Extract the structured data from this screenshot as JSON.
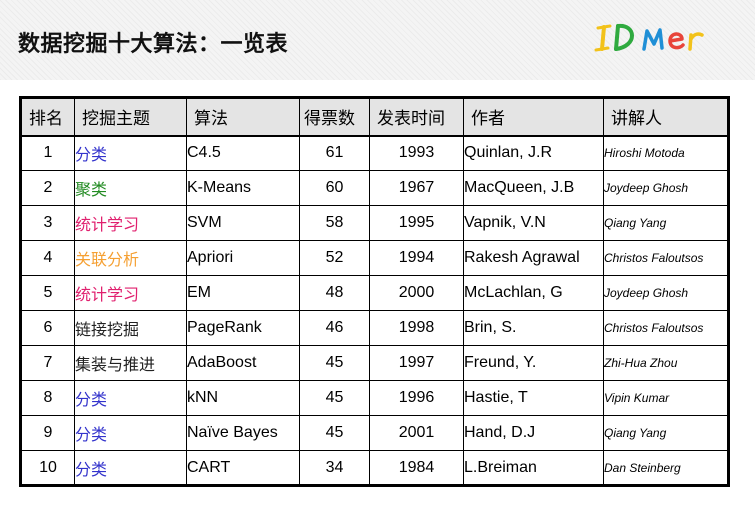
{
  "page": {
    "title": "数据挖掘十大算法：一览表",
    "logo_text": "IDMer"
  },
  "colors": {
    "topic_classification": "#3333cc",
    "topic_clustering": "#228b22",
    "topic_statistical_learning": "#e0206e",
    "topic_association": "#f5a033",
    "topic_default": "#222222",
    "header_background": "#e4e4e4"
  },
  "table": {
    "headers": {
      "rank": "排名",
      "topic": "挖掘主题",
      "algorithm": "算法",
      "votes": "得票数",
      "year": "发表时间",
      "author": "作者",
      "lecturer": "讲解人"
    },
    "rows": [
      {
        "rank": "1",
        "topic": "分类",
        "topic_color": "#3333cc",
        "algorithm": "C4.5",
        "votes": "61",
        "year": "1993",
        "author": "Quinlan, J.R",
        "lecturer": "Hiroshi Motoda"
      },
      {
        "rank": "2",
        "topic": "聚类",
        "topic_color": "#228b22",
        "algorithm": "K-Means",
        "votes": "60",
        "year": "1967",
        "author": "MacQueen, J.B",
        "lecturer": "Joydeep Ghosh"
      },
      {
        "rank": "3",
        "topic": "统计学习",
        "topic_color": "#e0206e",
        "algorithm": "SVM",
        "votes": "58",
        "year": "1995",
        "author": "Vapnik, V.N",
        "lecturer": "Qiang Yang"
      },
      {
        "rank": "4",
        "topic": "关联分析",
        "topic_color": "#f5a033",
        "algorithm": "Apriori",
        "votes": "52",
        "year": "1994",
        "author": "Rakesh Agrawal",
        "lecturer": "Christos Faloutsos"
      },
      {
        "rank": "5",
        "topic": "统计学习",
        "topic_color": "#e0206e",
        "algorithm": "EM",
        "votes": "48",
        "year": "2000",
        "author": "McLachlan, G",
        "lecturer": "Joydeep Ghosh"
      },
      {
        "rank": "6",
        "topic": "链接挖掘",
        "topic_color": "#222222",
        "algorithm": "PageRank",
        "votes": "46",
        "year": "1998",
        "author": "Brin, S.",
        "lecturer": "Christos Faloutsos"
      },
      {
        "rank": "7",
        "topic": "集装与推进",
        "topic_color": "#222222",
        "algorithm": "AdaBoost",
        "votes": "45",
        "year": "1997",
        "author": "Freund, Y.",
        "lecturer": "Zhi-Hua Zhou"
      },
      {
        "rank": "8",
        "topic": "分类",
        "topic_color": "#3333cc",
        "algorithm": "kNN",
        "votes": "45",
        "year": "1996",
        "author": "Hastie, T",
        "lecturer": "Vipin Kumar"
      },
      {
        "rank": "9",
        "topic": "分类",
        "topic_color": "#3333cc",
        "algorithm": "Naïve Bayes",
        "votes": "45",
        "year": "2001",
        "author": "Hand, D.J",
        "lecturer": "Qiang Yang"
      },
      {
        "rank": "10",
        "topic": "分类",
        "topic_color": "#3333cc",
        "algorithm": "CART",
        "votes": "34",
        "year": "1984",
        "author": "L.Breiman",
        "lecturer": "Dan Steinberg"
      }
    ]
  }
}
